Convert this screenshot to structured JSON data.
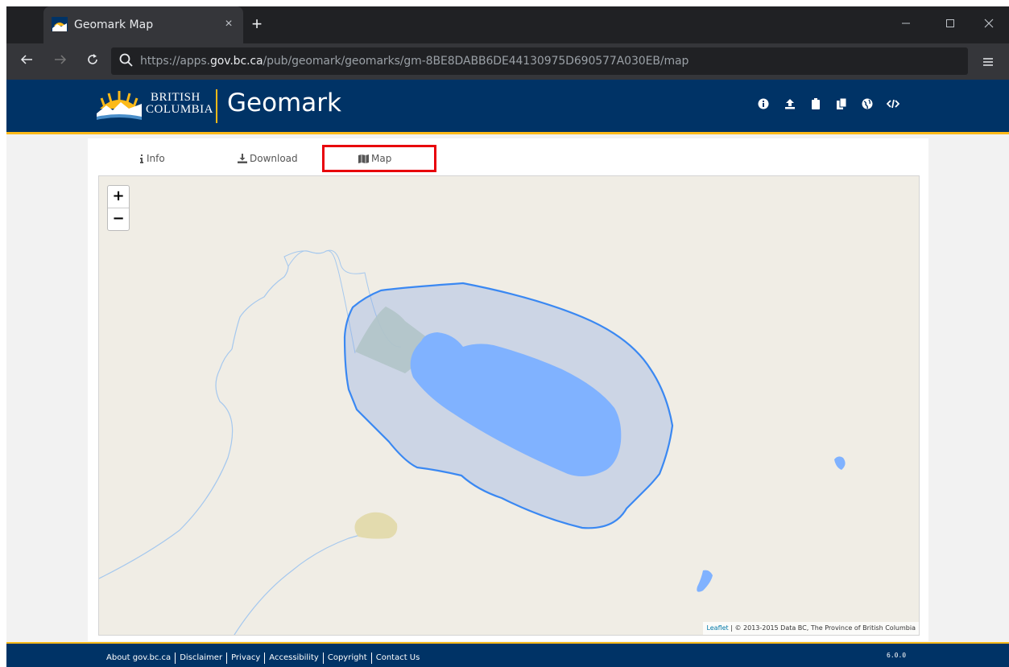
{
  "browser": {
    "tab_title": "Geomark Map",
    "tab_close": "×",
    "new_tab": "+",
    "url_prefix": "https://apps.",
    "url_host": "gov.bc.ca",
    "url_path": "/pub/geomark/geomarks/gm-8BE8DABB6DE44130975D690577A030EB/map",
    "window_controls": [
      "minimize-icon",
      "maximize-icon",
      "close-icon"
    ]
  },
  "header": {
    "logo_line1": "BRITISH",
    "logo_line2": "COLUMBIA",
    "title": "Geomark",
    "icons": [
      "info-icon",
      "upload-icon",
      "clipboard-icon",
      "copy-icon",
      "globe-icon",
      "code-icon"
    ]
  },
  "tabs": [
    {
      "label": "Info",
      "icon": "info-icon"
    },
    {
      "label": "Download",
      "icon": "download-icon"
    },
    {
      "label": "Map",
      "icon": "map-icon"
    }
  ],
  "map": {
    "zoom_in": "+",
    "zoom_out": "−",
    "attribution_link": "Leaflet",
    "attribution_text": " | © 2013-2015 Data BC, The Province of British Columbia"
  },
  "footer": {
    "links": [
      "About gov.bc.ca",
      "Disclaimer",
      "Privacy",
      "Accessibility",
      "Copyright",
      "Contact Us"
    ],
    "version": "6.0.0"
  },
  "colors": {
    "bc_blue": "#003366",
    "bc_gold": "#fcba19",
    "highlight": "#e8000b",
    "map_bg": "#f0ede5",
    "water": "#80b2ff",
    "polygon_stroke": "#3a88f2"
  }
}
